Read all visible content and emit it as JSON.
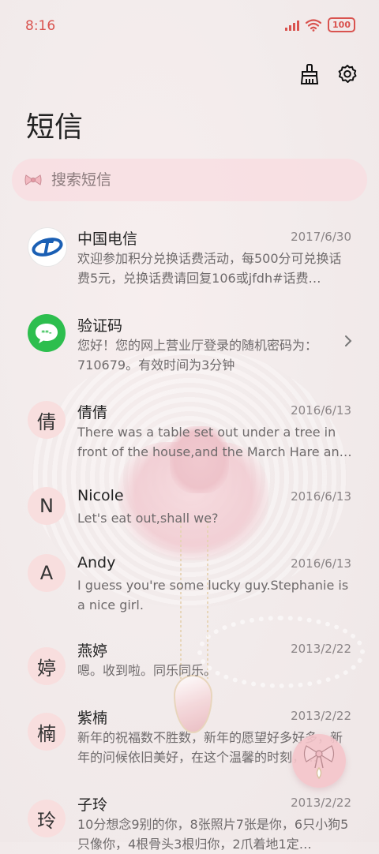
{
  "status_bar": {
    "time": "8:16",
    "battery": "100"
  },
  "header": {
    "title": "短信"
  },
  "search": {
    "placeholder": "搜索短信"
  },
  "messages": [
    {
      "avatar_text": "",
      "avatar_icon": "china-telecom-logo",
      "name": "中国电信",
      "date": "2017/6/30",
      "preview": "欢迎参加积分兑换话费活动，每500分可兑换话费5元，兑换话费请回复106或jfdh#话费…"
    },
    {
      "avatar_text": "",
      "avatar_icon": "chat-bubble-icon",
      "name": "验证码",
      "date": "",
      "preview": "您好！您的网上营业厅登录的随机密码为：710679。有效时间为3分钟"
    },
    {
      "avatar_text": "倩",
      "name": "倩倩",
      "date": "2016/6/13",
      "preview": "There was a table set out under a tree in front of the house,and the March Hare an…"
    },
    {
      "avatar_text": "N",
      "name": "Nicole",
      "date": "2016/6/13",
      "preview": "Let's eat out,shall we?"
    },
    {
      "avatar_text": "A",
      "name": "Andy",
      "date": "2016/6/13",
      "preview": "I guess you're some lucky guy.Stephanie is a nice girl."
    },
    {
      "avatar_text": "婷",
      "name": "燕婷",
      "date": "2013/2/22",
      "preview": "嗯。收到啦。同乐同乐。"
    },
    {
      "avatar_text": "楠",
      "name": "紫楠",
      "date": "2013/2/22",
      "preview": "新年的祝福数不胜数，新年的愿望好多好多，新年的问候依旧美好，在这个温馨的时刻，…"
    },
    {
      "avatar_text": "玲",
      "name": "子玲",
      "date": "2013/2/22",
      "preview": "10分想念9别的你，8张照片7张是你，6只小狗5只像你，4根骨头3根归你，2爪着地1定…"
    }
  ],
  "colors": {
    "accent": "#d9534f",
    "avatar_bg": "#f8dede",
    "search_bg": "#f8dee2"
  }
}
